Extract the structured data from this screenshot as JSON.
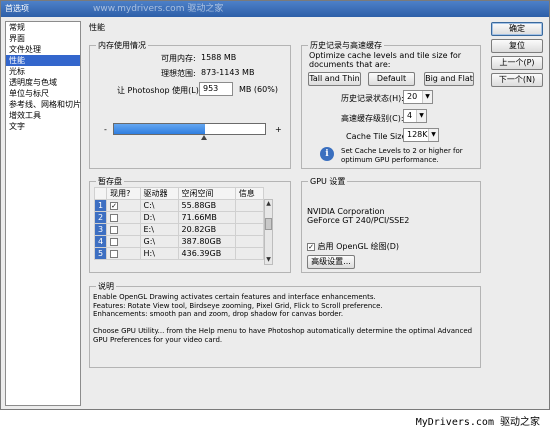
{
  "window": {
    "title": "首选项",
    "watermark": "www.mydrivers.com 驱动之家"
  },
  "sidebar": {
    "items": [
      {
        "label": "常规"
      },
      {
        "label": "界面"
      },
      {
        "label": "文件处理"
      },
      {
        "label": "性能",
        "selected": true
      },
      {
        "label": "光标"
      },
      {
        "label": "透明度与色域"
      },
      {
        "label": "单位与标尺"
      },
      {
        "label": "参考线、网格和切片"
      },
      {
        "label": "增效工具"
      },
      {
        "label": "文字"
      }
    ]
  },
  "main": {
    "title": "性能"
  },
  "memory": {
    "title": "内存使用情况",
    "available_label": "可用内存:",
    "available_value": "1588 MB",
    "ideal_label": "理想范围:",
    "ideal_value": "873-1143 MB",
    "let_label": "让 Photoshop 使用(L):",
    "let_value": "953",
    "let_unit": "MB (60%)",
    "slider_fraction": 0.6,
    "minus": "-",
    "plus": "+"
  },
  "history": {
    "title": "历史记录与高速缓存",
    "desc": "Optimize cache levels and tile size for documents that are:",
    "buttons": [
      "Tall and Thin",
      "Default",
      "Big and Flat"
    ],
    "states_label": "历史记录状态(H):",
    "states_value": "20",
    "cache_label": "高速缓存级别(C):",
    "cache_value": "4",
    "tile_label": "Cache Tile Size:",
    "tile_value": "128K",
    "info": "Set Cache Levels to 2 or higher for optimum GPU performance."
  },
  "scratch": {
    "title": "暂存盘",
    "headers": [
      "",
      "现用?",
      "驱动器",
      "空闲空间",
      "信息"
    ],
    "rows": [
      {
        "n": "1",
        "active": "✓",
        "drive": "C:\\",
        "free": "55.88GB",
        "info": ""
      },
      {
        "n": "2",
        "active": "",
        "drive": "D:\\",
        "free": "71.66MB",
        "info": ""
      },
      {
        "n": "3",
        "active": "",
        "drive": "E:\\",
        "free": "20.82GB",
        "info": ""
      },
      {
        "n": "4",
        "active": "",
        "drive": "G:\\",
        "free": "387.80GB",
        "info": ""
      },
      {
        "n": "5",
        "active": "",
        "drive": "H:\\",
        "free": "436.39GB",
        "info": ""
      }
    ]
  },
  "gpu": {
    "title": "GPU 设置",
    "vendor": "NVIDIA Corporation",
    "model": "GeForce GT 240/PCI/SSE2",
    "opengl_label": "启用 OpenGL 绘图(D)",
    "opengl_checked": "✓",
    "advanced_button": "高级设置..."
  },
  "description": {
    "title": "说明",
    "text": "Enable OpenGL Drawing activates certain features and interface enhancements.\nFeatures: Rotate View tool, Birdseye zooming, Pixel Grid, Flick to Scroll preference.\nEnhancements: smooth pan and zoom, drop shadow for canvas border.\n\nChoose GPU Utility... from the Help menu to have Photoshop automatically determine the optimal Advanced GPU Preferences for your video card."
  },
  "actions": {
    "ok": "确定",
    "reset": "复位",
    "prev": "上一个(P)",
    "next": "下一个(N)"
  },
  "footer": {
    "brand": "MyDrivers.com 驱动之家"
  }
}
